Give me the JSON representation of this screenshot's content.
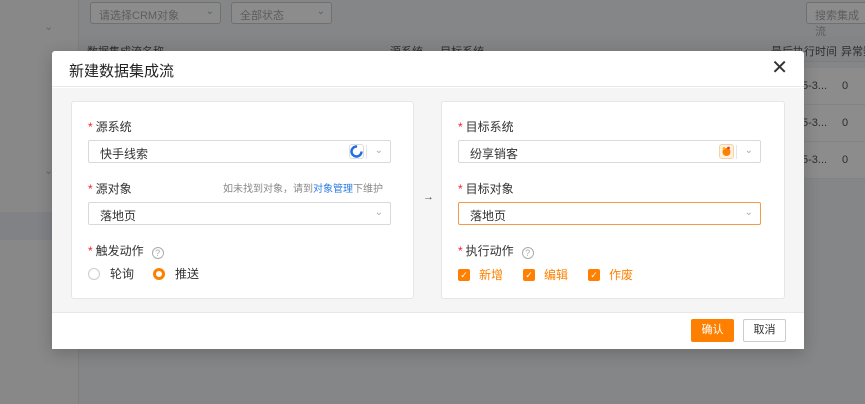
{
  "background": {
    "filters": {
      "crm_object_placeholder": "请选择CRM对象",
      "status_placeholder": "全部状态",
      "search_placeholder": "搜索集成流"
    },
    "table": {
      "headers": [
        "数据集成流名称",
        "源系统 → 目标系统",
        "最后执行时间",
        "异常数"
      ],
      "rows": [
        {
          "time": "5-3...",
          "errors": "0"
        },
        {
          "time": "5-3...",
          "errors": "0"
        },
        {
          "time": "5-3...",
          "errors": "0"
        }
      ]
    }
  },
  "modal": {
    "title": "新建数据集成流",
    "close_icon": "close-icon",
    "source": {
      "system_label": "源系统",
      "system_value": "快手线索",
      "object_label": "源对象",
      "object_hint_prefix": "如未找到对象，请到",
      "object_hint_link": "对象管理",
      "object_hint_suffix": "下维护",
      "object_value": "落地页",
      "trigger_label": "触发动作",
      "trigger_options": [
        "轮询",
        "推送"
      ],
      "trigger_selected": "推送"
    },
    "target": {
      "system_label": "目标系统",
      "system_value": "纷享销客",
      "object_label": "目标对象",
      "object_value": "落地页",
      "action_label": "执行动作",
      "actions": [
        "新增",
        "编辑",
        "作废"
      ]
    },
    "buttons": {
      "confirm": "确认",
      "cancel": "取消"
    }
  },
  "colors": {
    "accent": "#ff8000",
    "required": "#f5222d",
    "link": "#2f7de1"
  }
}
